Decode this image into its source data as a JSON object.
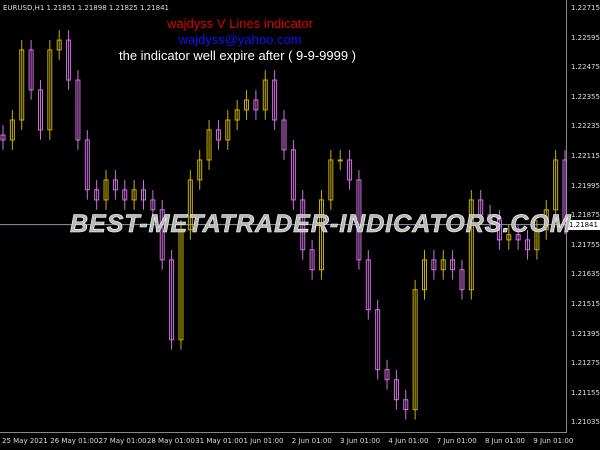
{
  "header": {
    "symbol_info": "EURUSD,H1  1.21851 1.21898 1.21825 1.21841"
  },
  "indicator_text": {
    "title": "wajdyss V Lines indicator",
    "email": "wajdyss@yahoo.com",
    "expiry": "the indicator well expire after ( 9-9-9999 )"
  },
  "watermark": "BEST-METATRADER-INDICATORS.COM",
  "colors": {
    "up": "#c8b000",
    "down": "#d070e0",
    "price_line": "#8899aa"
  },
  "chart_data": {
    "type": "candlestick",
    "symbol": "EURUSD",
    "timeframe": "H1",
    "current_price": "1.21841",
    "ylim": [
      1.2097,
      1.2277
    ],
    "y_ticks": [
      "1.22715",
      "1.22595",
      "1.22475",
      "1.22355",
      "1.22235",
      "1.22115",
      "1.21995",
      "1.21875",
      "1.21755",
      "1.21635",
      "1.21515",
      "1.21395",
      "1.21275",
      "1.21155",
      "1.21035"
    ],
    "x_ticks": [
      "25 May 2021",
      "26 May 01:00",
      "27 May 01:00",
      "28 May 01:00",
      "31 May 01:00",
      "1 Jun 01:00",
      "2 Jun 01:00",
      "3 Jun 01:00",
      "4 Jun 01:00",
      "7 Jun 01:00",
      "8 Jun 01:00",
      "9 Jun 01:00"
    ],
    "closes": [
      1.22184,
      1.22265,
      1.22549,
      1.22387,
      1.22225,
      1.22549,
      1.22589,
      1.22427,
      1.22184,
      1.21982,
      1.21941,
      1.22022,
      1.21982,
      1.21941,
      1.21982,
      1.21941,
      1.21901,
      1.21698,
      1.21374,
      1.2182,
      1.22022,
      1.22103,
      1.22225,
      1.22184,
      1.22265,
      1.22306,
      1.22346,
      1.22306,
      1.22427,
      1.22265,
      1.22144,
      1.21941,
      1.21739,
      1.21658,
      1.21941,
      1.22103,
      1.22103,
      1.22022,
      1.21698,
      1.21496,
      1.21253,
      1.21212,
      1.21131,
      1.21091,
      1.21577,
      1.21698,
      1.21658,
      1.21698,
      1.21658,
      1.21577,
      1.21941,
      1.21881,
      1.2186,
      1.21779,
      1.218,
      1.21779,
      1.21739,
      1.2182,
      1.21901,
      1.22103,
      1.21841
    ]
  }
}
